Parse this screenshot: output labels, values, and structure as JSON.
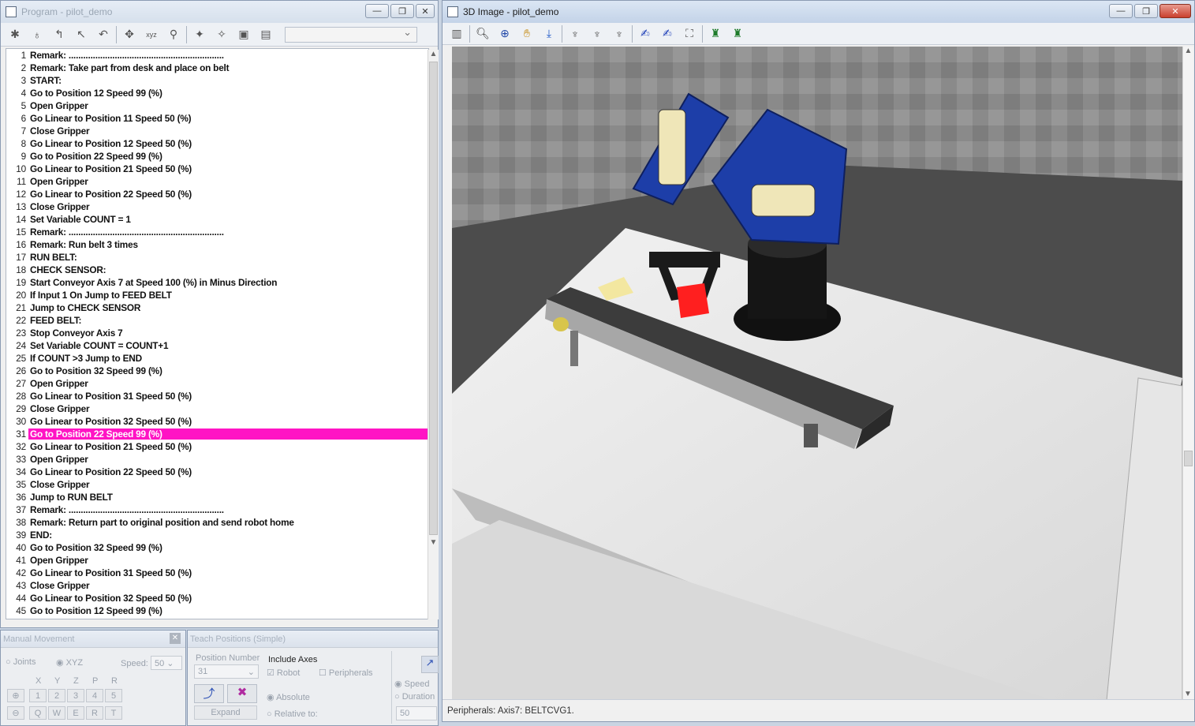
{
  "program_window": {
    "title": "Program - pilot_demo",
    "buttons": [
      "—",
      "❐",
      "✕"
    ],
    "lines": [
      {
        "n": 1,
        "t": "Remark: ................................................................"
      },
      {
        "n": 2,
        "t": "Remark: Take part from desk and place on belt"
      },
      {
        "n": 3,
        "t": "START:"
      },
      {
        "n": 4,
        "t": "Go to Position 12 Speed 99 (%)"
      },
      {
        "n": 5,
        "t": "Open Gripper"
      },
      {
        "n": 6,
        "t": "Go Linear to Position 11 Speed 50 (%)"
      },
      {
        "n": 7,
        "t": "Close Gripper"
      },
      {
        "n": 8,
        "t": "Go Linear to Position 12 Speed 50 (%)"
      },
      {
        "n": 9,
        "t": "Go to Position 22 Speed 99 (%)"
      },
      {
        "n": 10,
        "t": "Go Linear to Position 21 Speed 50 (%)"
      },
      {
        "n": 11,
        "t": "Open Gripper"
      },
      {
        "n": 12,
        "t": "Go Linear to Position 22 Speed 50 (%)"
      },
      {
        "n": 13,
        "t": "Close Gripper"
      },
      {
        "n": 14,
        "t": "Set Variable COUNT  = 1"
      },
      {
        "n": 15,
        "t": "Remark: ................................................................"
      },
      {
        "n": 16,
        "t": "Remark: Run belt 3 times"
      },
      {
        "n": 17,
        "t": "RUN BELT:"
      },
      {
        "n": 18,
        "t": "CHECK SENSOR:"
      },
      {
        "n": 19,
        "t": "Start Conveyor Axis 7 at Speed 100 (%) in Minus Direction"
      },
      {
        "n": 20,
        "t": "If Input 1 On Jump to FEED BELT"
      },
      {
        "n": 21,
        "t": "Jump to CHECK SENSOR"
      },
      {
        "n": 22,
        "t": "FEED BELT:"
      },
      {
        "n": 23,
        "t": "Stop Conveyor Axis 7"
      },
      {
        "n": 24,
        "t": "Set Variable COUNT  = COUNT+1"
      },
      {
        "n": 25,
        "t": "If COUNT >3 Jump to END"
      },
      {
        "n": 26,
        "t": "Go to Position 32 Speed 99 (%)"
      },
      {
        "n": 27,
        "t": "Open Gripper"
      },
      {
        "n": 28,
        "t": "Go Linear to Position 31 Speed 50 (%)"
      },
      {
        "n": 29,
        "t": "Close Gripper"
      },
      {
        "n": 30,
        "t": "Go Linear to Position 32 Speed 50 (%)"
      },
      {
        "n": 31,
        "t": "Go to Position 22 Speed 99 (%)"
      },
      {
        "n": 32,
        "t": "Go Linear to Position 21 Speed 50 (%)"
      },
      {
        "n": 33,
        "t": "Open Gripper"
      },
      {
        "n": 34,
        "t": "Go Linear to Position 22 Speed 50 (%)"
      },
      {
        "n": 35,
        "t": "Close Gripper"
      },
      {
        "n": 36,
        "t": "Jump to RUN BELT"
      },
      {
        "n": 37,
        "t": "Remark: ................................................................"
      },
      {
        "n": 38,
        "t": "Remark: Return part to original position and send robot home"
      },
      {
        "n": 39,
        "t": "END:"
      },
      {
        "n": 40,
        "t": "Go to Position 32 Speed 99 (%)"
      },
      {
        "n": 41,
        "t": "Open Gripper"
      },
      {
        "n": 42,
        "t": "Go Linear to Position 31 Speed 50 (%)"
      },
      {
        "n": 43,
        "t": "Close Gripper"
      },
      {
        "n": 44,
        "t": "Go Linear to Position 32 Speed 50 (%)"
      },
      {
        "n": 45,
        "t": "Go to Position 12 Speed 99 (%)"
      }
    ],
    "highlighted_line": 31,
    "highlight_color": "#ff14c4"
  },
  "manual_movement": {
    "title": "Manual Movement",
    "joints_label": "Joints",
    "xyz_label": "XYZ",
    "speed_label": "Speed:",
    "speed_value": "50",
    "axis_headers": [
      "X",
      "Y",
      "Z",
      "P",
      "R"
    ],
    "row1": [
      "1",
      "2",
      "3",
      "4",
      "5"
    ],
    "row2": [
      "Q",
      "W",
      "E",
      "R",
      "T"
    ]
  },
  "teach_positions": {
    "title": "Teach Positions (Simple)",
    "position_number_label": "Position Number",
    "position_number_value": "31",
    "include_axes_label": "Include Axes",
    "robot_label": "Robot",
    "peripherals_label": "Peripherals",
    "absolute_label": "Absolute",
    "relative_label": "Relative to:",
    "expand_label": "Expand",
    "speed_label": "Speed",
    "duration_label": "Duration",
    "speed_value": "50"
  },
  "image_window": {
    "title": "3D Image -  pilot_demo",
    "buttons": [
      "—",
      "❐",
      "✕"
    ],
    "status": "Peripherals: Axis7: BELTCVG1."
  }
}
